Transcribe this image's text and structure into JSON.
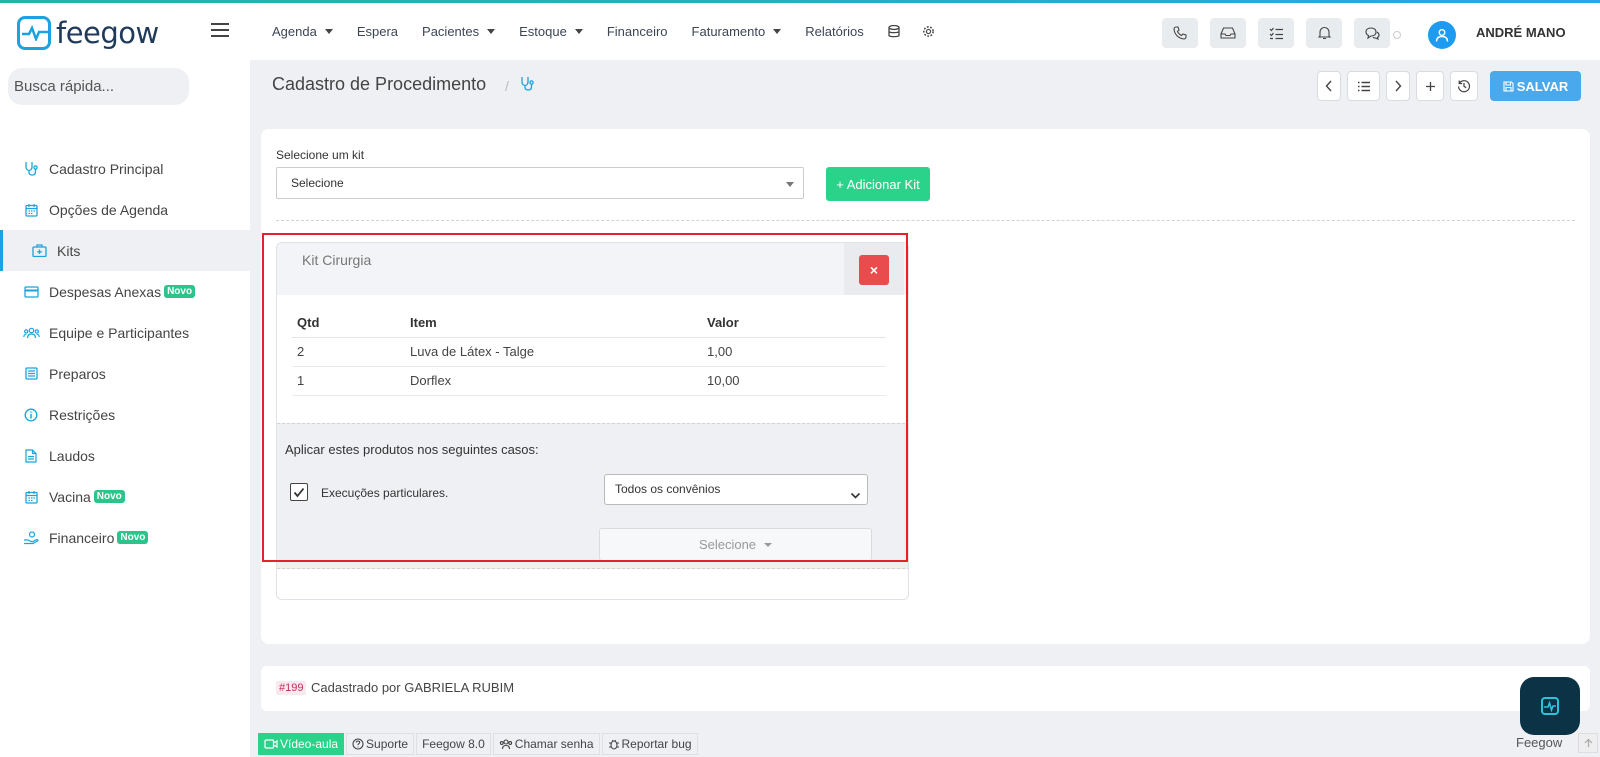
{
  "app": {
    "brand": "feegow",
    "user_name": "ANDRÉ MANO",
    "accent_color": "#1aa3dc"
  },
  "topnav": {
    "items": [
      {
        "label": "Agenda",
        "dropdown": true
      },
      {
        "label": "Espera",
        "dropdown": false
      },
      {
        "label": "Pacientes",
        "dropdown": true
      },
      {
        "label": "Estoque",
        "dropdown": true
      },
      {
        "label": "Financeiro",
        "dropdown": false
      },
      {
        "label": "Faturamento",
        "dropdown": true
      },
      {
        "label": "Relatórios",
        "dropdown": false
      }
    ],
    "icons": [
      "database-icon",
      "gear-icon"
    ]
  },
  "header_buttons": [
    "phone-icon",
    "inbox-icon",
    "checklist-icon",
    "bell-icon",
    "chat-icon"
  ],
  "sidebar": {
    "search_placeholder": "Busca rápida...",
    "items": [
      {
        "label": "Cadastro Principal",
        "icon": "stethoscope-icon",
        "badge": ""
      },
      {
        "label": "Opções de Agenda",
        "icon": "calendar-icon",
        "badge": ""
      },
      {
        "label": "Kits",
        "icon": "medkit-icon",
        "badge": "",
        "active": true
      },
      {
        "label": "Despesas Anexas",
        "icon": "credit-card-icon",
        "badge": "Novo"
      },
      {
        "label": "Equipe e Participantes",
        "icon": "users-icon",
        "badge": ""
      },
      {
        "label": "Preparos",
        "icon": "list-icon",
        "badge": ""
      },
      {
        "label": "Restrições",
        "icon": "info-icon",
        "badge": ""
      },
      {
        "label": "Laudos",
        "icon": "file-icon",
        "badge": ""
      },
      {
        "label": "Vacina",
        "icon": "calendar-icon",
        "badge": "Novo"
      },
      {
        "label": "Financeiro",
        "icon": "hand-money-icon",
        "badge": "Novo"
      }
    ]
  },
  "page": {
    "title": "Cadastro de Procedimento",
    "crumb_sep": "/",
    "save_label": "SALVAR"
  },
  "kit_form": {
    "select_label": "Selecione um kit",
    "select_value": "Selecione",
    "add_button": "+ Adicionar Kit"
  },
  "kit": {
    "name": "Kit Cirurgia",
    "remove_label": "×",
    "columns": [
      "Qtd",
      "Item",
      "Valor"
    ],
    "rows": [
      {
        "qtd": "2",
        "item": "Luva de Látex - Talge",
        "valor": "1,00"
      },
      {
        "qtd": "1",
        "item": "Dorflex",
        "valor": "10,00"
      }
    ],
    "apply_title": "Aplicar estes produtos nos seguintes casos:",
    "checkbox_label": "Execuções particulares.",
    "checkbox_checked": true,
    "convenio_value": "Todos os convênios",
    "secondary_select": "Selecione"
  },
  "footer_card": {
    "id": "#199",
    "created_by": "Cadastrado por GABRIELA RUBIM"
  },
  "bottombar": {
    "video": "Vídeo-aula",
    "support": "Suporte",
    "version": "Feegow 8.0",
    "call": "Chamar senha",
    "bug": "Reportar bug",
    "brand": "Feegow"
  }
}
